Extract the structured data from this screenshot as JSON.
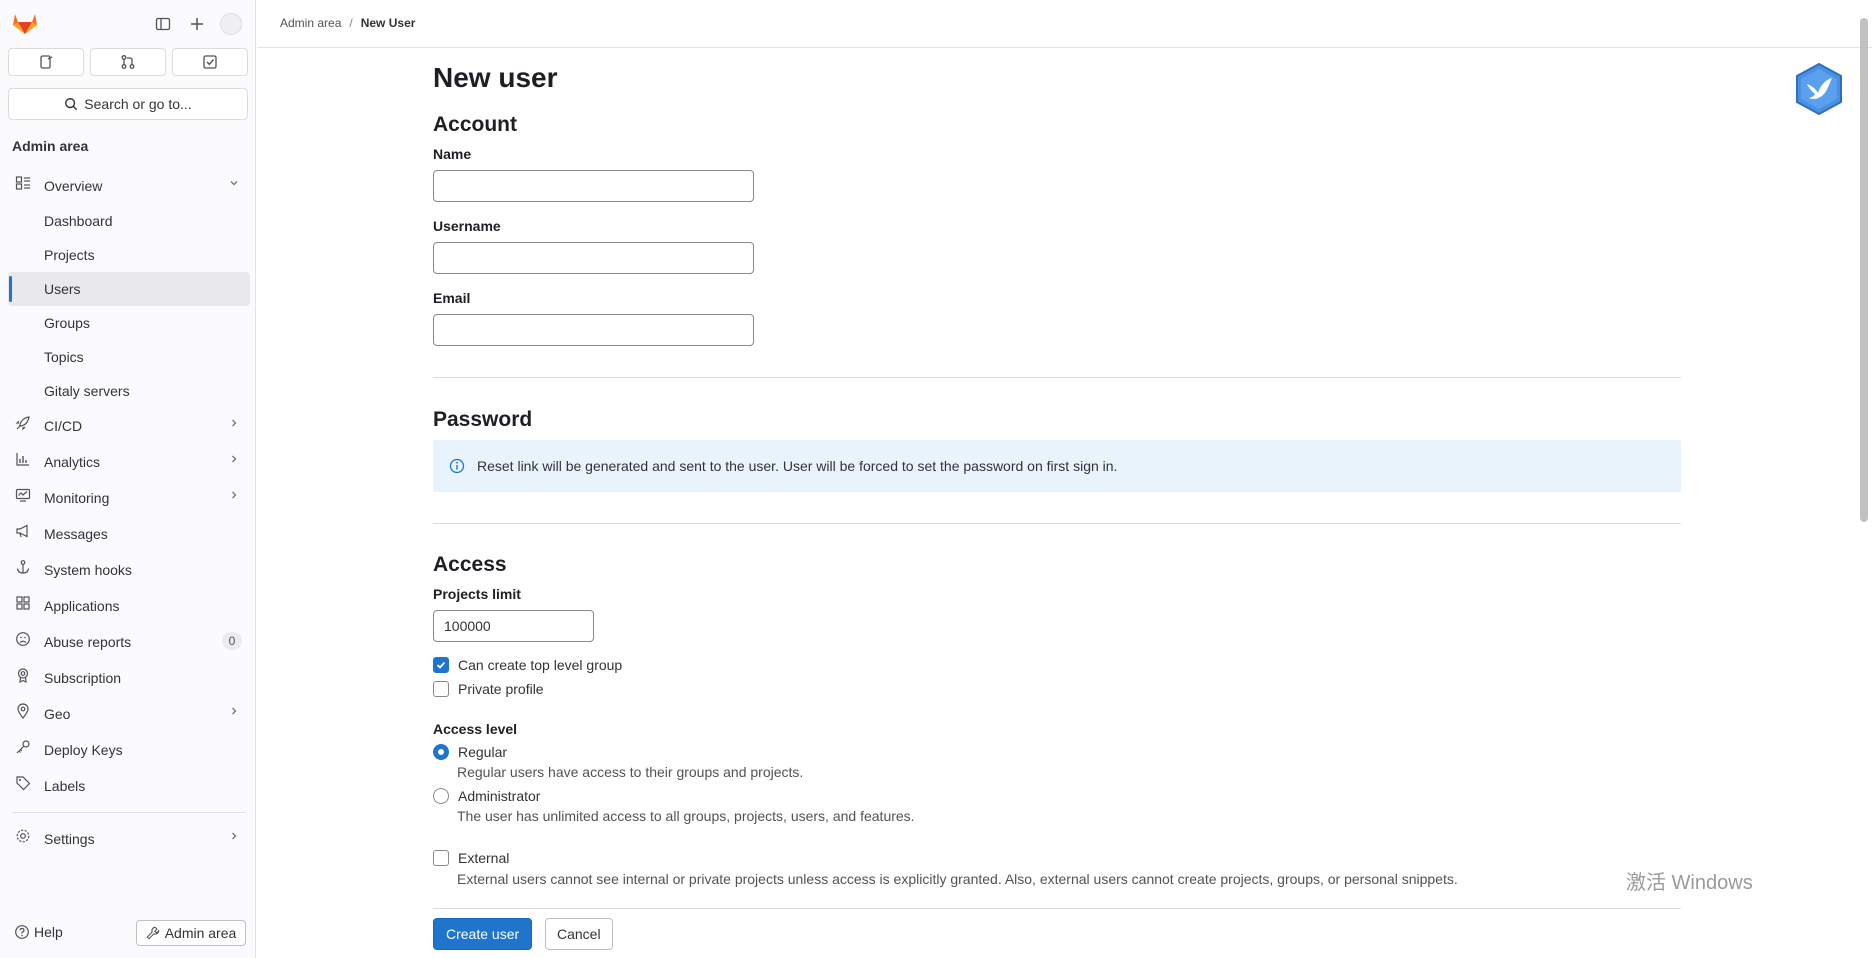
{
  "sidebar": {
    "search_placeholder": "Search or go to...",
    "section_title": "Admin area",
    "items": [
      {
        "label": "Overview",
        "icon": "overview-icon",
        "expanded": true
      },
      {
        "label": "Dashboard"
      },
      {
        "label": "Projects"
      },
      {
        "label": "Users",
        "active": true
      },
      {
        "label": "Groups"
      },
      {
        "label": "Topics"
      },
      {
        "label": "Gitaly servers"
      },
      {
        "label": "CI/CD",
        "icon": "rocket-icon"
      },
      {
        "label": "Analytics",
        "icon": "chart-icon"
      },
      {
        "label": "Monitoring",
        "icon": "monitor-icon"
      },
      {
        "label": "Messages",
        "icon": "bullhorn-icon"
      },
      {
        "label": "System hooks",
        "icon": "anchor-icon"
      },
      {
        "label": "Applications",
        "icon": "apps-icon"
      },
      {
        "label": "Abuse reports",
        "icon": "abuse-icon",
        "badge": "0"
      },
      {
        "label": "Subscription",
        "icon": "subscription-icon"
      },
      {
        "label": "Geo",
        "icon": "location-icon"
      },
      {
        "label": "Deploy Keys",
        "icon": "key-icon"
      },
      {
        "label": "Labels",
        "icon": "label-icon"
      },
      {
        "label": "Settings",
        "icon": "settings-icon"
      }
    ],
    "help_label": "Help",
    "admin_button_label": "Admin area"
  },
  "breadcrumb": {
    "parent": "Admin area",
    "separator": "/",
    "current": "New User"
  },
  "page": {
    "title": "New user",
    "account": {
      "heading": "Account",
      "name_label": "Name",
      "name_value": "",
      "username_label": "Username",
      "username_value": "",
      "email_label": "Email",
      "email_value": ""
    },
    "password": {
      "heading": "Password",
      "alert_text": "Reset link will be generated and sent to the user. User will be forced to set the password on first sign in."
    },
    "access": {
      "heading": "Access",
      "projects_limit_label": "Projects limit",
      "projects_limit_value": "100000",
      "can_create_group_label": "Can create top level group",
      "can_create_group_checked": true,
      "private_profile_label": "Private profile",
      "private_profile_checked": false,
      "access_level_label": "Access level",
      "regular_label": "Regular",
      "regular_help": "Regular users have access to their groups and projects.",
      "admin_label": "Administrator",
      "admin_help": "The user has unlimited access to all groups, projects, users, and features.",
      "selected_level": "Regular",
      "external_label": "External",
      "external_help": "External users cannot see internal or private projects unless access is explicitly granted. Also, external users cannot create projects, groups, or personal snippets.",
      "external_checked": false
    },
    "buttons": {
      "create": "Create user",
      "cancel": "Cancel"
    }
  },
  "watermark": "激活 Windows",
  "colors": {
    "accent": "#1f75cb",
    "alert_bg": "#e9f3fc",
    "brand_orange": "#fc6d26"
  }
}
